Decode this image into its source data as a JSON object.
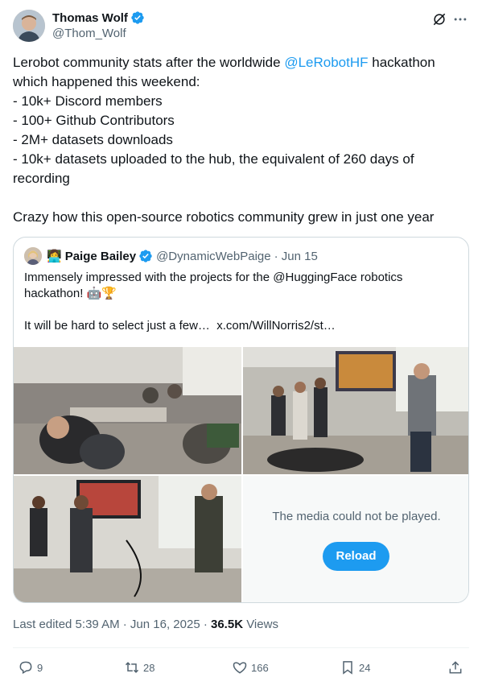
{
  "author": {
    "name": "Thomas Wolf",
    "handle": "@Thom_Wolf"
  },
  "tweet": {
    "text_before": "Lerobot community stats after the worldwide ",
    "mention": "@LeRobotHF",
    "text_after": " hackathon\nwhich happened this weekend:\n- 10k+ Discord members\n- 100+ Github Contributors\n- 2M+ datasets downloads\n- 10k+ datasets uploaded to the hub, the equivalent of 260 days of\nrecording\n\nCrazy how this open-source robotics community grew in just one year"
  },
  "quote": {
    "emoji": "👩‍💻",
    "name": "Paige Bailey",
    "handle": "@DynamicWebPaige",
    "date": "· Jun 15",
    "text": "Immensely impressed with the projects for the @HuggingFace robotics\nhackathon! 🤖🏆\n\nIt will be hard to select just a few…  x.com/WillNorris2/st…",
    "media_error": "The media could not be played.",
    "reload_label": "Reload"
  },
  "meta": {
    "edited": "Last edited 5:39 AM · Jun 16, 2025 · ",
    "views_count": "36.5K",
    "views_label": " Views"
  },
  "actions": {
    "replies": "9",
    "reposts": "28",
    "likes": "166",
    "bookmarks": "24"
  },
  "colors": {
    "accent": "#1d9bf0",
    "text": "#0f1419",
    "secondary": "#536471",
    "border": "#cfd9de"
  }
}
